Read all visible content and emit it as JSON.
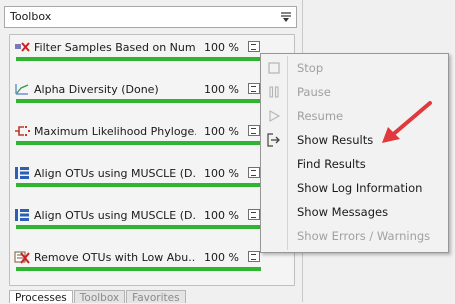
{
  "panel": {
    "title": "Toolbox"
  },
  "processes": [
    {
      "name": "Filter Samples Based on Num...",
      "percent": "100 %",
      "progress": 100,
      "icon": "filter-samples-icon"
    },
    {
      "name": "Alpha Diversity (Done)",
      "percent": "100 %",
      "progress": 100,
      "icon": "alpha-diversity-icon"
    },
    {
      "name": "Maximum Likelihood Phyloge...",
      "percent": "100 %",
      "progress": 100,
      "icon": "phylogeny-icon"
    },
    {
      "name": "Align OTUs using MUSCLE (D...",
      "percent": "100 %",
      "progress": 100,
      "icon": "align-otus-icon"
    },
    {
      "name": "Align OTUs using MUSCLE (D...",
      "percent": "100 %",
      "progress": 100,
      "icon": "align-otus-icon"
    },
    {
      "name": "Remove OTUs with Low Abu...",
      "percent": "100 %",
      "progress": 100,
      "icon": "remove-otus-icon"
    }
  ],
  "tabs": [
    {
      "label": "Processes",
      "active": true
    },
    {
      "label": "Toolbox",
      "active": false
    },
    {
      "label": "Favorites",
      "active": false
    }
  ],
  "context_menu": {
    "items": [
      {
        "label": "Stop",
        "enabled": false,
        "icon": "stop-icon"
      },
      {
        "label": "Pause",
        "enabled": false,
        "icon": "pause-icon"
      },
      {
        "label": "Resume",
        "enabled": false,
        "icon": "resume-icon"
      },
      {
        "label": "Show Results",
        "enabled": true,
        "icon": "show-results-icon"
      },
      {
        "label": "Find Results",
        "enabled": true,
        "icon": ""
      },
      {
        "label": "Show Log Information",
        "enabled": true,
        "icon": ""
      },
      {
        "label": "Show Messages",
        "enabled": true,
        "icon": ""
      },
      {
        "label": "Show Errors / Warnings",
        "enabled": false,
        "icon": ""
      }
    ]
  },
  "colors": {
    "progress": "#2fb52f",
    "arrow": "#e0393e"
  }
}
